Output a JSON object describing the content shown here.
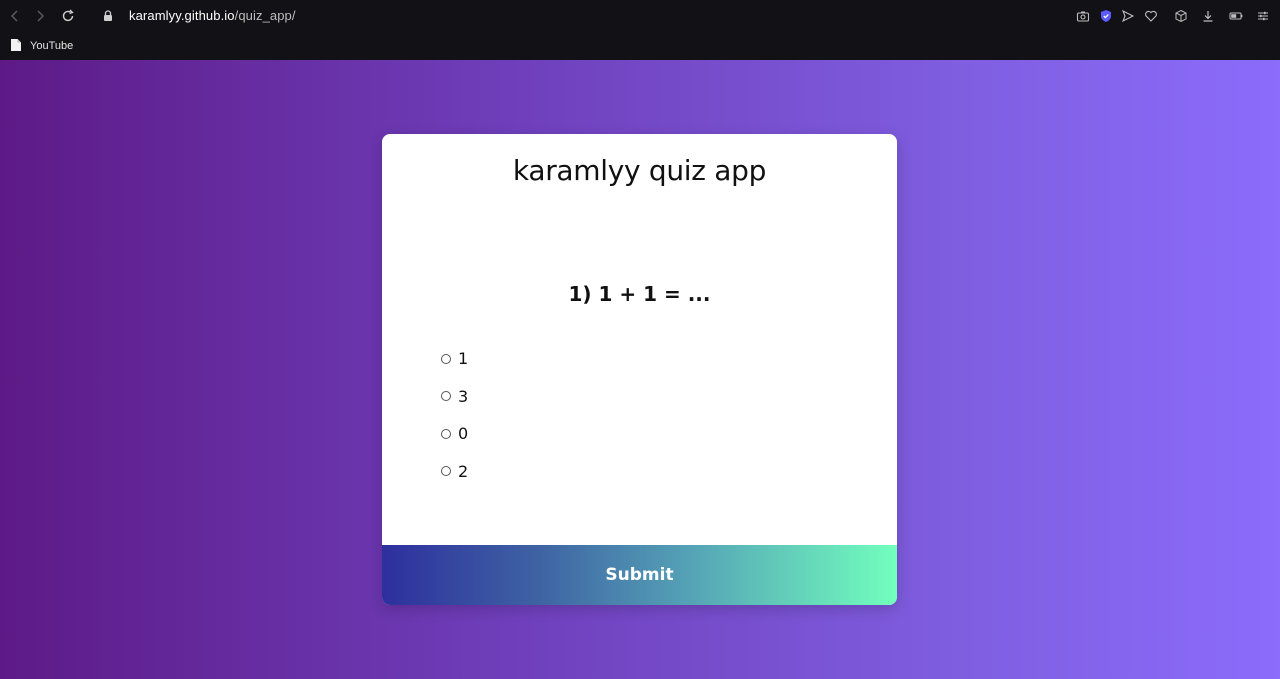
{
  "browser": {
    "url_host": "karamlyy.github.io",
    "url_path": "/quiz_app/",
    "bookmarks": [
      {
        "label": "YouTube",
        "icon": "file-icon"
      }
    ],
    "toolbar_icons": [
      "back-icon",
      "forward-icon",
      "reload-icon",
      "lock-icon",
      "camera-icon",
      "shield-icon",
      "send-icon",
      "heart-icon",
      "cube-icon",
      "download-icon",
      "battery-icon",
      "settings-sliders-icon"
    ],
    "accent_color": "#5b5bff"
  },
  "quiz": {
    "title": "karamlyy quiz app",
    "question": "1) 1 + 1 = ...",
    "answers": [
      "1",
      "3",
      "0",
      "2"
    ],
    "submit_label": "Submit"
  },
  "colors": {
    "background_left": "#5d1a87",
    "background_right": "#8b6cfb",
    "submit_gradient_start": "#2e2f9e",
    "submit_gradient_end": "#72ffbd"
  }
}
